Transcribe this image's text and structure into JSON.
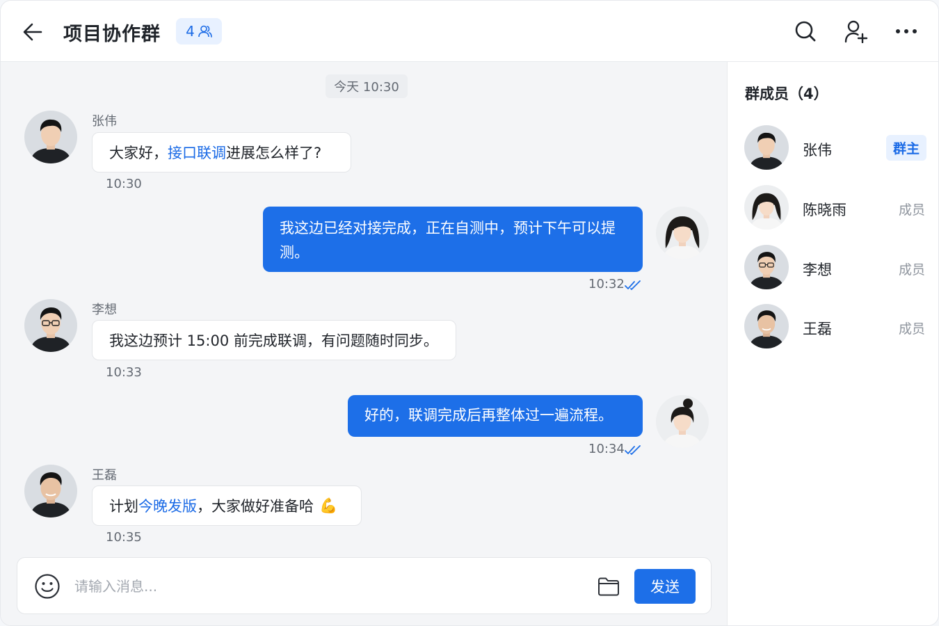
{
  "header": {
    "title": "项目协作群",
    "member_count": "4"
  },
  "chat": {
    "date_divider": "今天 10:30",
    "messages": [
      {
        "sender": "张伟",
        "direction": "in",
        "text_before": "大家好，",
        "text_highlight": "接口联调",
        "text_after": "进展怎么样了?",
        "time": "10:30"
      },
      {
        "direction": "out",
        "text": "我这边已经对接完成，正在自测中，预计下午可以提测。",
        "time": "10:32",
        "read": true
      },
      {
        "sender": "李想",
        "direction": "in",
        "text": "我这边预计 15:00 前完成联调，有问题随时同步。",
        "time": "10:33"
      },
      {
        "direction": "out",
        "text": "好的，联调完成后再整体过一遍流程。",
        "time": "10:34",
        "read": true
      },
      {
        "sender": "王磊",
        "direction": "in",
        "text_before": "计划",
        "text_highlight": "今晚发版",
        "text_after": "，大家做好准备哈",
        "emoji": "💪",
        "time": "10:35"
      }
    ]
  },
  "composer": {
    "placeholder": "请输入消息...",
    "send_label": "发送"
  },
  "members": {
    "title": "群成员（4）",
    "list": [
      {
        "name": "张伟",
        "role": "群主"
      },
      {
        "name": "陈晓雨",
        "role": "成员"
      },
      {
        "name": "李想",
        "role": "成员"
      },
      {
        "name": "王磊",
        "role": "成员"
      }
    ]
  },
  "colors": {
    "accent": "#1d6fe8",
    "highlight_text": "#1a6ae6",
    "badge_bg": "#e8f1ff",
    "chat_bg": "#f4f5f7"
  },
  "icons": [
    "arrow-left-icon",
    "people-icon",
    "search-icon",
    "add-user-icon",
    "more-icon",
    "double-check-icon",
    "emoji-icon",
    "folder-icon"
  ]
}
